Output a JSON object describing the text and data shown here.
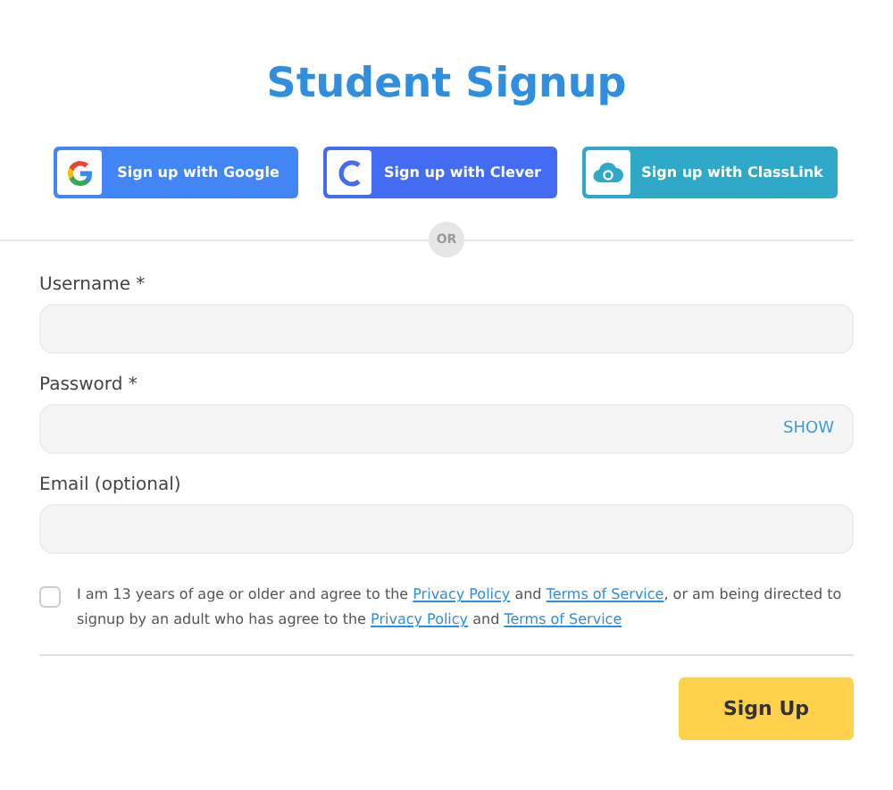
{
  "title": "Student Signup",
  "sso_buttons": [
    {
      "kind": "google",
      "label": "Sign up with Google"
    },
    {
      "kind": "clever",
      "label": "Sign up with Clever"
    },
    {
      "kind": "classlink",
      "label": "Sign up with ClassLink"
    }
  ],
  "divider": "OR",
  "fields": [
    {
      "label": "Username *"
    },
    {
      "label": "Password *",
      "toggle": "SHOW"
    },
    {
      "label": "Email (optional)"
    }
  ],
  "agreement": {
    "checked": false,
    "parts": [
      {
        "text": "I am 13 years of age or older and agree to the ",
        "kind": "text"
      },
      {
        "text": "Privacy Policy",
        "kind": "link"
      },
      {
        "text": " and ",
        "kind": "text"
      },
      {
        "text": "Terms of Service",
        "kind": "link"
      },
      {
        "text": ", or am being directed to signup by an adult who has agree to the ",
        "kind": "text"
      },
      {
        "text": "Privacy Policy",
        "kind": "link"
      },
      {
        "text": " and ",
        "kind": "text"
      },
      {
        "text": "Terms of Service",
        "kind": "link"
      }
    ]
  },
  "submit": "Sign Up"
}
